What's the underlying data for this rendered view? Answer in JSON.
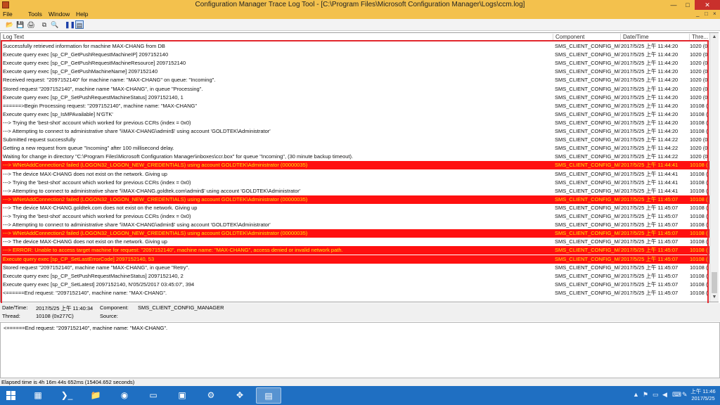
{
  "window": {
    "title": "Configuration Manager Trace Log Tool - [C:\\Program Files\\Microsoft Configuration Manager\\Logs\\ccm.log]",
    "minimize": "—",
    "maximize": "□",
    "close": "✕"
  },
  "menu": [
    "File",
    "Tools",
    "Window",
    "Help"
  ],
  "mdi_controls": [
    "_",
    "□",
    "×"
  ],
  "toolbar": {
    "open_icon": "📂",
    "save_icon": "💾",
    "print_icon": "🖨",
    "copy_icon": "⧉",
    "find_icon": "🔍",
    "pause_icon": "❚❚",
    "view_icon": "▤"
  },
  "grid": {
    "headers": [
      "Log Text",
      "Component",
      "Date/Time",
      "Thre..."
    ],
    "rows": [
      {
        "text": "Successfully retrieved information for machine MAX-CHANG from DB",
        "comp": "SMS_CLIENT_CONFIG_M/",
        "date": "2017/5/25 上午 11:44:20",
        "thr": "1020 (0:",
        "err": false
      },
      {
        "text": "Execute query exec [sp_CP_GetPushRequestMachineIP] 2097152140",
        "comp": "SMS_CLIENT_CONFIG_M/",
        "date": "2017/5/25 上午 11:44:20",
        "thr": "1020 (0:",
        "err": false
      },
      {
        "text": "Execute query exec [sp_CP_GetPushRequestMachineResource] 2097152140",
        "comp": "SMS_CLIENT_CONFIG_M/",
        "date": "2017/5/25 上午 11:44:20",
        "thr": "1020 (0:",
        "err": false
      },
      {
        "text": "Execute query exec [sp_CP_GetPushMachineName] 2097152140",
        "comp": "SMS_CLIENT_CONFIG_M/",
        "date": "2017/5/25 上午 11:44:20",
        "thr": "1020 (0:",
        "err": false
      },
      {
        "text": "Received request: \"2097152140\" for machine name: \"MAX-CHANG\" on queue: \"Incoming\".",
        "comp": "SMS_CLIENT_CONFIG_M/",
        "date": "2017/5/25 上午 11:44:20",
        "thr": "1020 (0:",
        "err": false
      },
      {
        "text": "Stored request \"2097152140\", machine name \"MAX-CHANG\", in queue \"Processing\".",
        "comp": "SMS_CLIENT_CONFIG_M/",
        "date": "2017/5/25 上午 11:44:20",
        "thr": "1020 (0:",
        "err": false
      },
      {
        "text": "Execute query exec [sp_CP_SetPushRequestMachineStatus] 2097152140, 1",
        "comp": "SMS_CLIENT_CONFIG_M/",
        "date": "2017/5/25 上午 11:44:20",
        "thr": "1020 (0:",
        "err": false
      },
      {
        "text": "======>Begin Processing request: \"2097152140\", machine name: \"MAX-CHANG\"",
        "comp": "SMS_CLIENT_CONFIG_M/",
        "date": "2017/5/25 上午 11:44:20",
        "thr": "10108 (I",
        "err": false
      },
      {
        "text": "Execute query exec [sp_IsMPAvailable] N'GTK'",
        "comp": "SMS_CLIENT_CONFIG_M/",
        "date": "2017/5/25 上午 11:44:20",
        "thr": "10108 (I",
        "err": false
      },
      {
        "text": "---> Trying the 'best-shot' account which worked for previous CCRs (index = 0x0)",
        "comp": "SMS_CLIENT_CONFIG_M/",
        "date": "2017/5/25 上午 11:44:20",
        "thr": "10108 (I",
        "err": false
      },
      {
        "text": "---> Attempting to connect to administrative share '\\\\MAX-CHANG\\admin$' using account 'GOLDTEK\\Administrator'",
        "comp": "SMS_CLIENT_CONFIG_M/",
        "date": "2017/5/25 上午 11:44:20",
        "thr": "10108 (I",
        "err": false
      },
      {
        "text": "Submitted request successfully",
        "comp": "SMS_CLIENT_CONFIG_M/",
        "date": "2017/5/25 上午 11:44:22",
        "thr": "1020 (0:",
        "err": false
      },
      {
        "text": "Getting a new request from queue \"Incoming\" after 100 millisecond delay.",
        "comp": "SMS_CLIENT_CONFIG_M/",
        "date": "2017/5/25 上午 11:44:22",
        "thr": "1020 (0:",
        "err": false
      },
      {
        "text": "Waiting for change in directory \"C:\\Program Files\\Microsoft Configuration Manager\\inboxes\\ccr.box\" for queue \"Incoming\", (30 minute backup timeout).",
        "comp": "SMS_CLIENT_CONFIG_M/",
        "date": "2017/5/25 上午 11:44:22",
        "thr": "1020 (0:",
        "err": false
      },
      {
        "text": "---> WNetAddConnection2 failed (LOGON32_LOGON_NEW_CREDENTIALS) using account GOLDTEK\\Administrator (00000035)",
        "comp": "SMS_CLIENT_CONFIG_M/",
        "date": "2017/5/25 上午 11:44:41",
        "thr": "10108 (I",
        "err": true
      },
      {
        "text": "---> The device MAX-CHANG does not exist on the network. Giving up",
        "comp": "SMS_CLIENT_CONFIG_M/",
        "date": "2017/5/25 上午 11:44:41",
        "thr": "10108 (I",
        "err": false
      },
      {
        "text": "---> Trying the 'best-shot' account which worked for previous CCRs (index = 0x0)",
        "comp": "SMS_CLIENT_CONFIG_M/",
        "date": "2017/5/25 上午 11:44:41",
        "thr": "10108 (I",
        "err": false
      },
      {
        "text": "---> Attempting to connect to administrative share '\\\\MAX-CHANG.goldtek.com\\admin$' using account 'GOLDTEK\\Administrator'",
        "comp": "SMS_CLIENT_CONFIG_M/",
        "date": "2017/5/25 上午 11:44:41",
        "thr": "10108 (I",
        "err": false
      },
      {
        "text": "---> WNetAddConnection2 failed (LOGON32_LOGON_NEW_CREDENTIALS) using account GOLDTEK\\Administrator (00000035)",
        "comp": "SMS_CLIENT_CONFIG_M/",
        "date": "2017/5/25 上午 11:45:07",
        "thr": "10108 (I",
        "err": true
      },
      {
        "text": "---> The device MAX-CHANG.goldtek.com does not exist on the network. Giving up",
        "comp": "SMS_CLIENT_CONFIG_M/",
        "date": "2017/5/25 上午 11:45:07",
        "thr": "10108 (I",
        "err": false
      },
      {
        "text": "---> Trying the 'best-shot' account which worked for previous CCRs (index = 0x0)",
        "comp": "SMS_CLIENT_CONFIG_M/",
        "date": "2017/5/25 上午 11:45:07",
        "thr": "10108 (I",
        "err": false
      },
      {
        "text": "---> Attempting to connect to administrative share '\\\\MAX-CHANG\\admin$' using account 'GOLDTEK\\Administrator'",
        "comp": "SMS_CLIENT_CONFIG_M/",
        "date": "2017/5/25 上午 11:45:07",
        "thr": "10108 (I",
        "err": false
      },
      {
        "text": "---> WNetAddConnection2 failed (LOGON32_LOGON_NEW_CREDENTIALS) using account GOLDTEK\\Administrator (00000035)",
        "comp": "SMS_CLIENT_CONFIG_M/",
        "date": "2017/5/25 上午 11:45:07",
        "thr": "10108 (I",
        "err": true
      },
      {
        "text": "---> The device MAX-CHANG does not exist on the network. Giving up",
        "comp": "SMS_CLIENT_CONFIG_M/",
        "date": "2017/5/25 上午 11:45:07",
        "thr": "10108 (I",
        "err": false
      },
      {
        "text": "---> ERROR: Unable to access target machine for request: \"2097152140\", machine name: \"MAX-CHANG\",  access denied or invalid network path.",
        "comp": "SMS_CLIENT_CONFIG_M/",
        "date": "2017/5/25 上午 11:45:07",
        "thr": "10108 (I",
        "err": true
      },
      {
        "text": "Execute query exec [sp_CP_SetLastErrorCode] 2097152140, 53",
        "comp": "SMS_CLIENT_CONFIG_M/",
        "date": "2017/5/25 上午 11:45:07",
        "thr": "10108 (I",
        "err": true
      },
      {
        "text": "Stored request \"2097152140\", machine name \"MAX-CHANG\", in queue \"Retry\".",
        "comp": "SMS_CLIENT_CONFIG_M/",
        "date": "2017/5/25 上午 11:45:07",
        "thr": "10108 (I",
        "err": false
      },
      {
        "text": "Execute query exec [sp_CP_SetPushRequestMachineStatus] 2097152140, 2",
        "comp": "SMS_CLIENT_CONFIG_M/",
        "date": "2017/5/25 上午 11:45:07",
        "thr": "10108 (I",
        "err": false
      },
      {
        "text": "Execute query exec [sp_CP_SetLatest] 2097152140, N'05/25/2017 03:45:07', 394",
        "comp": "SMS_CLIENT_CONFIG_M/",
        "date": "2017/5/25 上午 11:45:07",
        "thr": "10108 (I",
        "err": false
      },
      {
        "text": "<======End request: \"2097152140\", machine name: \"MAX-CHANG\".",
        "comp": "SMS_CLIENT_CONFIG_M/",
        "date": "2017/5/25 上午 11:45:07",
        "thr": "10108 (I",
        "err": false
      }
    ]
  },
  "details": {
    "datetime_label": "Date/Time:",
    "datetime_value": "2017/5/25 上午 11:40:34",
    "component_label": "Component:",
    "component_value": "SMS_CLIENT_CONFIG_MANAGER",
    "thread_label": "Thread:",
    "thread_value": "10108 (0x277C)",
    "source_label": "Source:",
    "source_value": "",
    "text": "<======End request: \"2097152140\", machine name: \"MAX-CHANG\"."
  },
  "status": "Elapsed time is 4h 16m 44s 652ms (15404.652 seconds)",
  "taskbar": {
    "items": [
      {
        "name": "server-manager-icon",
        "glyph": "▦"
      },
      {
        "name": "powershell-icon",
        "glyph": "❯_"
      },
      {
        "name": "file-explorer-icon",
        "glyph": "📁"
      },
      {
        "name": "firefox-icon",
        "glyph": "◉"
      },
      {
        "name": "blank-app-icon",
        "glyph": "▭"
      },
      {
        "name": "config-manager-console-icon",
        "glyph": "▣"
      },
      {
        "name": "settings-app-icon",
        "glyph": "⚙"
      },
      {
        "name": "tools-app-icon",
        "glyph": "✥"
      },
      {
        "name": "trace-log-tool-icon",
        "glyph": "▤"
      }
    ],
    "clock_time": "上午 11:46",
    "clock_date": "2017/5/25"
  },
  "colors": {
    "titlebar": "#f3c14d",
    "error_row_bg": "#ff1010",
    "error_row_text": "#ffe600",
    "taskbar": "#1f6fc2",
    "highlight_frame": "#e2262c"
  }
}
